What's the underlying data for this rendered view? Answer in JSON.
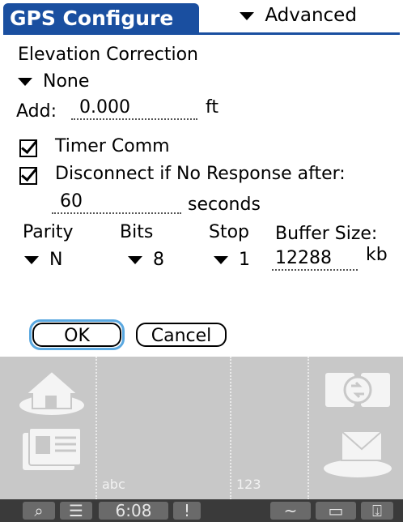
{
  "header": {
    "title": "GPS Configure",
    "menu_label": "Advanced"
  },
  "elevation": {
    "label": "Elevation Correction",
    "value": "None",
    "add_label": "Add:",
    "add_value": "0.000",
    "add_unit": "ft"
  },
  "options": {
    "timer_comm": {
      "label": "Timer Comm",
      "checked": true
    },
    "disconnect": {
      "label": "Disconnect if No Response after:",
      "checked": true
    },
    "timeout_value": "60",
    "timeout_unit": "seconds"
  },
  "serial": {
    "parity_label": "Parity",
    "parity_value": "N",
    "bits_label": "Bits",
    "bits_value": "8",
    "stop_label": "Stop",
    "stop_value": "1",
    "buffer_label": "Buffer Size:",
    "buffer_value": "12288",
    "buffer_unit": "kb"
  },
  "buttons": {
    "ok": "OK",
    "cancel": "Cancel"
  },
  "graffiti": {
    "abc_label": "abc",
    "num_label": "123"
  },
  "statusbar": {
    "time": "6:08"
  },
  "colors": {
    "title_blue": "#1a4fa0",
    "graffiti_gray": "#c8c8c8",
    "status_bar": "#3a3a3a"
  }
}
